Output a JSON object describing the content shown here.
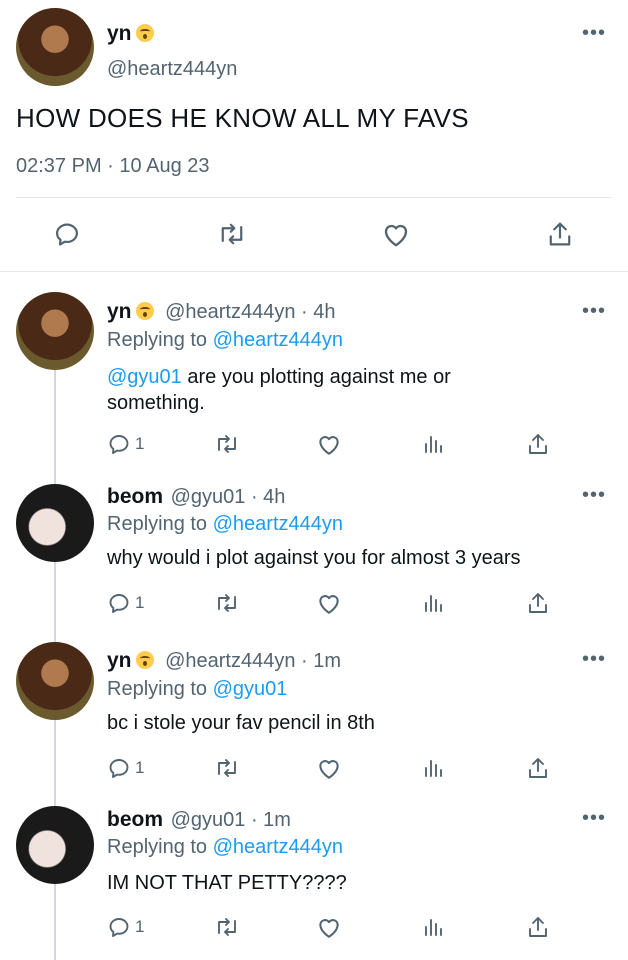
{
  "main_tweet": {
    "name": "yn",
    "handle": "@heartz444yn",
    "text": "HOW DOES HE KNOW ALL MY FAVS",
    "time": "02:37 PM",
    "sep": "·",
    "date": "10 Aug 23",
    "more": "•••"
  },
  "replies": [
    {
      "name": "yn",
      "handle": "@heartz444yn",
      "sep": "·",
      "age": "4h",
      "replying_prefix": "Replying to",
      "replying_to": "@heartz444yn",
      "mention": "@gyu01",
      "text": "are you plotting against me or",
      "text2": "something.",
      "reply_count": "1",
      "more": "•••"
    },
    {
      "name": "beom",
      "handle": "@gyu01",
      "sep": "·",
      "age": "4h",
      "replying_prefix": "Replying to",
      "replying_to": "@heartz444yn",
      "text": "why would i plot against you for almost 3 years",
      "reply_count": "1",
      "more": "•••"
    },
    {
      "name": "yn",
      "handle": "@heartz444yn",
      "sep": "·",
      "age": "1m",
      "replying_prefix": "Replying to",
      "replying_to": "@gyu01",
      "text": "bc i stole your fav pencil in 8th",
      "reply_count": "1",
      "more": "•••"
    },
    {
      "name": "beom",
      "handle": "@gyu01",
      "sep": "·",
      "age": "1m",
      "replying_prefix": "Replying to",
      "replying_to": "@heartz444yn",
      "text": "IM NOT THAT PETTY????",
      "reply_count": "1",
      "more": "•••"
    }
  ],
  "icons": [
    "reply-icon",
    "retweet-icon",
    "like-icon",
    "views-icon",
    "share-icon"
  ],
  "colors": {
    "link": "#1d9bf0",
    "muted": "#536471",
    "text": "#0f1419"
  }
}
